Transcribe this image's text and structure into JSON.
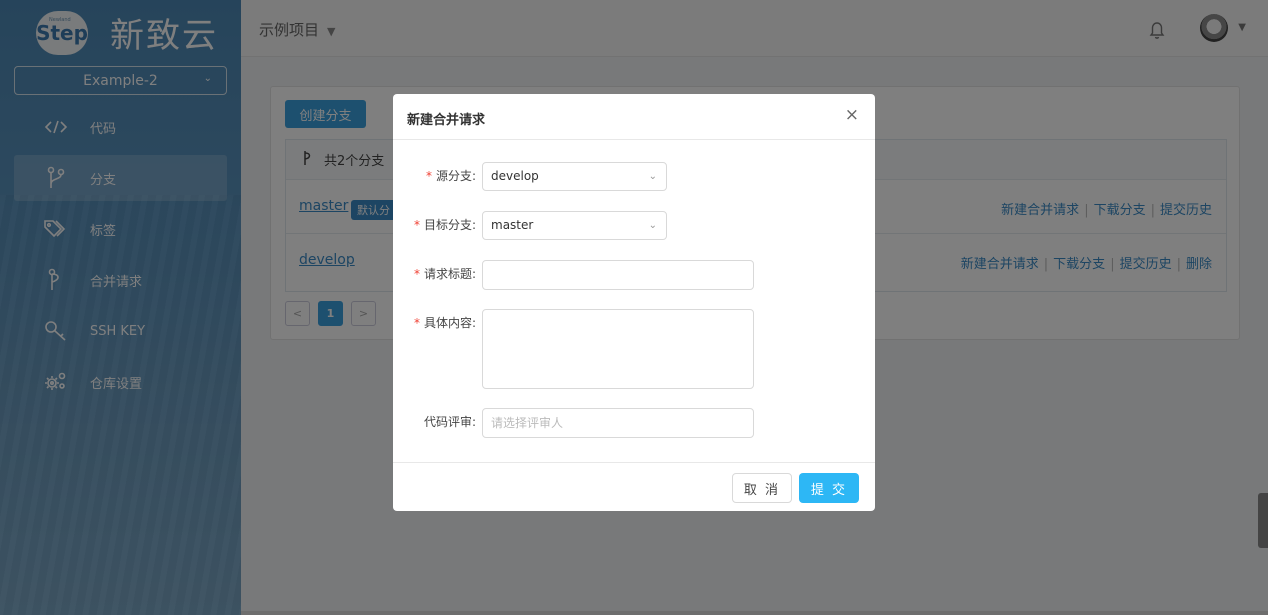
{
  "logo": {
    "badge": "Step",
    "badge_small": "Newland",
    "name": "新致云"
  },
  "project_selector": {
    "value": "Example-2"
  },
  "sidebar": {
    "items": [
      {
        "label": "代码",
        "icon": "code-icon"
      },
      {
        "label": "分支",
        "icon": "branch-icon",
        "active": true
      },
      {
        "label": "标签",
        "icon": "tag-icon"
      },
      {
        "label": "合并请求",
        "icon": "merge-request-icon"
      },
      {
        "label": "SSH KEY",
        "icon": "key-icon"
      },
      {
        "label": "仓库设置",
        "icon": "gears-icon"
      }
    ]
  },
  "header": {
    "project": "示例项目"
  },
  "branches": {
    "create_button": "创建分支",
    "count_label": "共2个分支",
    "rows": [
      {
        "name": "master",
        "tag": "默认分",
        "actions": [
          "新建合并请求",
          "下载分支",
          "提交历史"
        ]
      },
      {
        "name": "develop",
        "actions": [
          "新建合并请求",
          "下载分支",
          "提交历史",
          "删除"
        ]
      }
    ],
    "pagination": {
      "prev": "<",
      "current": "1",
      "next": ">"
    }
  },
  "modal": {
    "title": "新建合并请求",
    "close": "×",
    "fields": {
      "source": {
        "label": "源分支:",
        "value": "develop"
      },
      "target": {
        "label": "目标分支:",
        "value": "master"
      },
      "title": {
        "label": "请求标题:",
        "value": ""
      },
      "content": {
        "label": "具体内容:",
        "value": ""
      },
      "reviewer": {
        "label": "代码评审:",
        "placeholder": "请选择评审人"
      }
    },
    "cancel": "取 消",
    "submit": "提 交"
  },
  "colors": {
    "primary": "#2db7f5",
    "link": "#3a8bc6",
    "sidebar": "#4d89b6"
  }
}
